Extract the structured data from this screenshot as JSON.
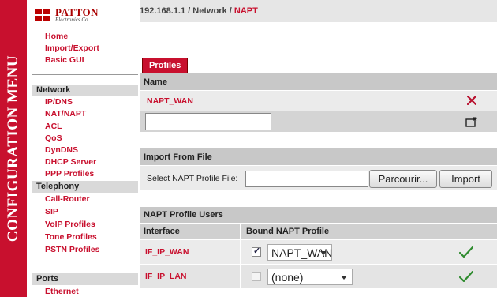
{
  "side_menu": {
    "vertical_label": "CONFIGURATION MENU"
  },
  "logo": {
    "name": "PATTON",
    "sub": "Electronics Co."
  },
  "nav": {
    "top_links": [
      "Home",
      "Import/Export",
      "Basic GUI"
    ],
    "sections": [
      {
        "header": "Network",
        "items": [
          "IP/DNS",
          "NAT/NAPT",
          "ACL",
          "QoS",
          "DynDNS",
          "DHCP Server",
          "PPP Profiles"
        ]
      },
      {
        "header": "Telephony",
        "items": [
          "Call-Router",
          "SIP",
          "VoIP Profiles",
          "Tone Profiles",
          "PSTN Profiles"
        ]
      },
      {
        "header": "Ports",
        "items": [
          "Ethernet"
        ]
      }
    ]
  },
  "breadcrumb": {
    "ip": "192.168.1.1",
    "sep1": " / ",
    "section": "Network",
    "sep2": " / ",
    "current": "NAPT"
  },
  "profiles": {
    "tab_label": "Profiles",
    "header_name": "Name",
    "rows": [
      {
        "name": "NAPT_WAN"
      }
    ],
    "new_name_value": ""
  },
  "import": {
    "title": "Import From File",
    "label": "Select NAPT Profile File:",
    "file_value": "",
    "browse_label": "Parcourir...",
    "import_label": "Import"
  },
  "users": {
    "title": "NAPT Profile Users",
    "col_interface": "Interface",
    "col_bound": "Bound NAPT Profile",
    "rows": [
      {
        "interface": "IF_IP_WAN",
        "checked": true,
        "profile": "NAPT_WAN"
      },
      {
        "interface": "IF_IP_LAN",
        "checked": false,
        "profile": "(none)"
      }
    ]
  },
  "colors": {
    "accent": "#c8102e",
    "header_bg": "#c8c8c8",
    "row_bg": "#ebebeb",
    "topbar": "#e6e6e6",
    "check": "#2e8b2e"
  }
}
